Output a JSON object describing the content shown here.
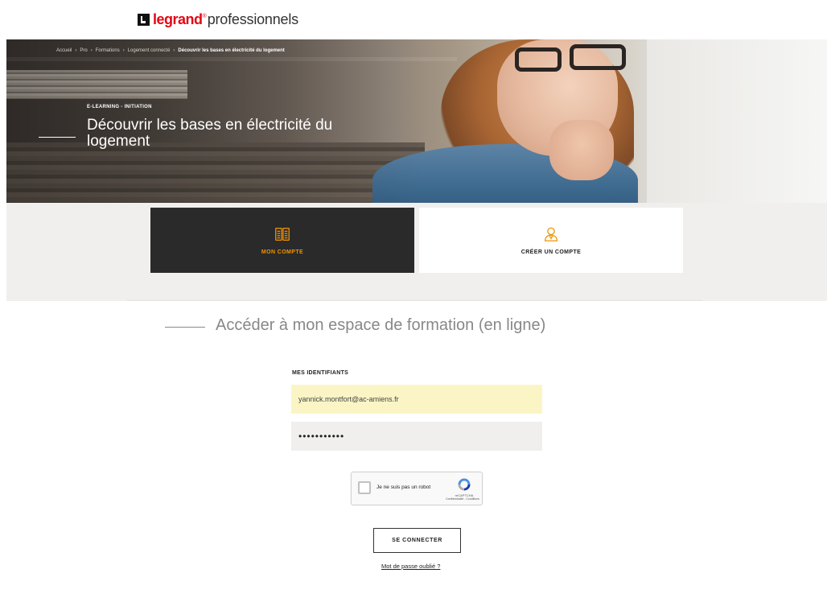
{
  "header": {
    "brand": "legrand",
    "brand_suffix": "professionnels",
    "colors": {
      "brand_red": "#e30613"
    }
  },
  "hero": {
    "breadcrumb": [
      {
        "label": "Accueil"
      },
      {
        "label": "Pro"
      },
      {
        "label": "Formations"
      },
      {
        "label": "Logement connecté"
      },
      {
        "label": "Découvrir les bases en électricité du logement"
      }
    ],
    "kicker": "E-LEARNING - INITIATION",
    "title": "Découvrir les bases en électricité du logement"
  },
  "account_tabs": [
    {
      "label": "MON COMPTE",
      "icon": "book-icon",
      "active": true,
      "accent": "#f29400"
    },
    {
      "label": "CRÉER UN COMPTE",
      "icon": "user-badge-icon",
      "active": false,
      "accent": "#f29400"
    }
  ],
  "section": {
    "title": "Accéder à mon espace de formation (en ligne)"
  },
  "form": {
    "label": "MES IDENTIFIANTS",
    "email_value": "yannick.montfort@ac-amiens.fr",
    "password_value": "•••••••••••",
    "captcha": {
      "label": "Je ne suis pas un robot",
      "brand": "reCAPTCHA",
      "links": "Confidentialité - Conditions"
    },
    "submit_label": "SE CONNECTER",
    "forgot_label": "Mot de passe oublié ?"
  }
}
